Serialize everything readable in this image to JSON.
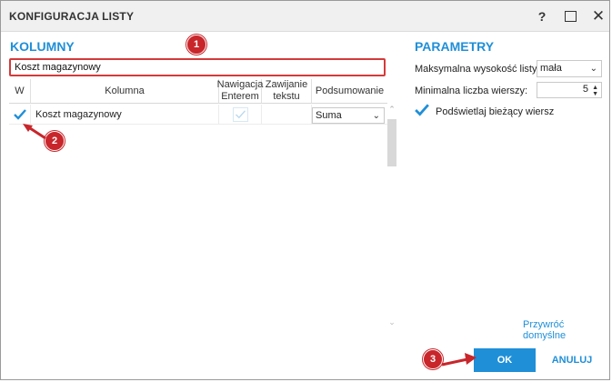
{
  "window": {
    "title": "KONFIGURACJA LISTY",
    "help": "?",
    "close": "✕"
  },
  "columns_section": {
    "title": "KOLUMNY",
    "search_value": "Koszt magazynowy"
  },
  "grid": {
    "headers": [
      "W",
      "Kolumna",
      "Nawigacja Enterem",
      "Zawijanie tekstu",
      "Podsumowanie"
    ],
    "rows": [
      {
        "checked": true,
        "name": "Koszt magazynowy",
        "enter_nav": true,
        "wrap": false,
        "summary": "Suma"
      }
    ]
  },
  "params_section": {
    "title": "PARAMETRY",
    "max_height_label": "Maksymalna wysokość listy:",
    "max_height_value": "mała",
    "min_rows_label": "Minimalna liczba wierszy:",
    "min_rows_value": "5",
    "highlight_label": "Podświetlaj bieżący wiersz",
    "highlight_checked": true
  },
  "footer": {
    "restore": "Przywróć domyślne",
    "ok": "OK",
    "cancel": "ANULUJ"
  },
  "callouts": [
    "1",
    "2",
    "3"
  ],
  "colors": {
    "accent": "#1f8fd8",
    "callout": "#c8262b"
  }
}
